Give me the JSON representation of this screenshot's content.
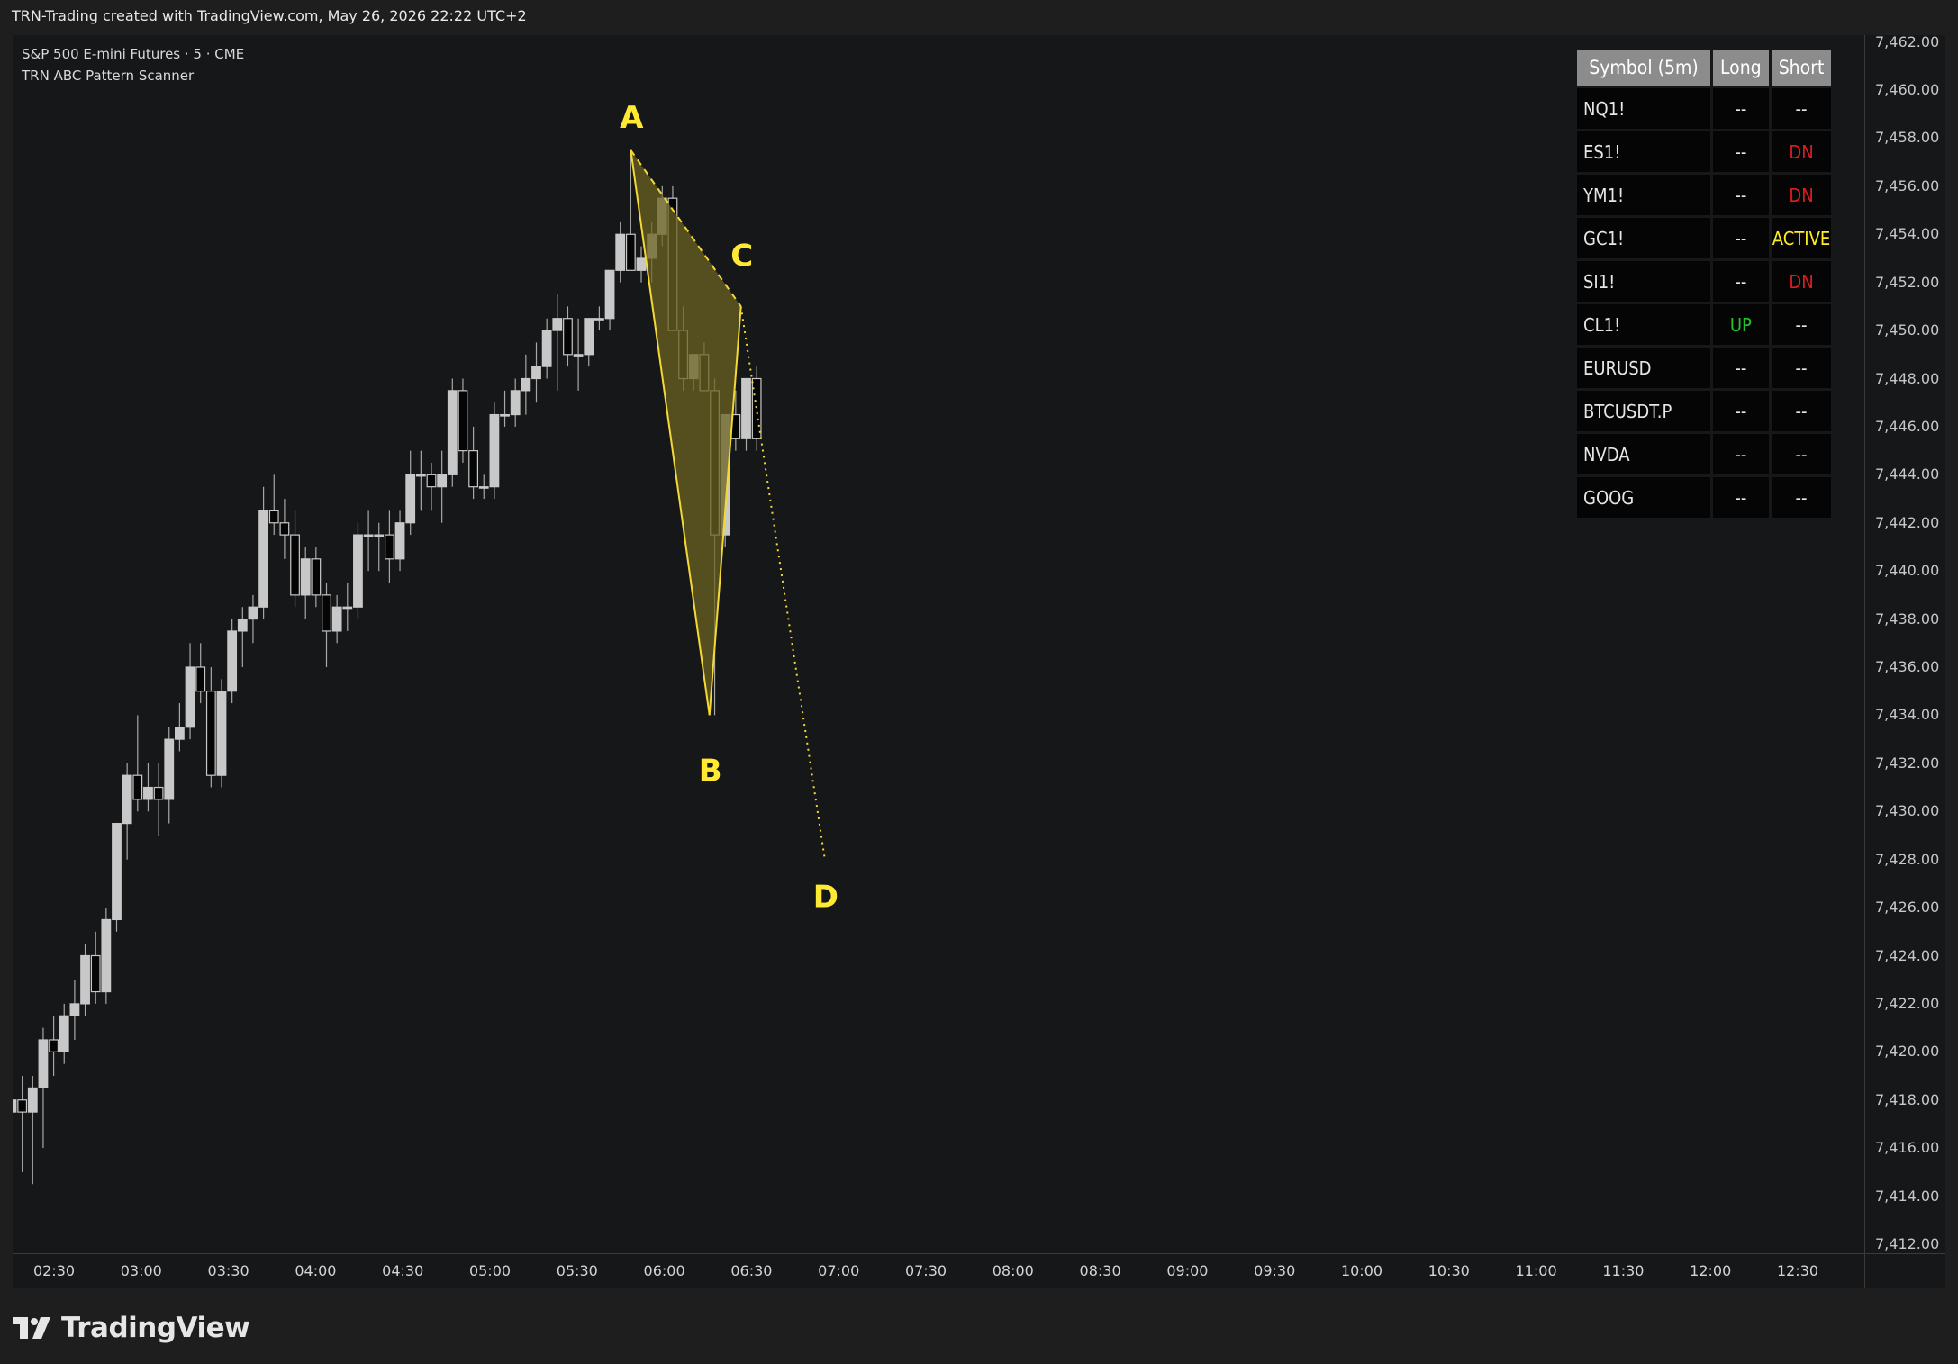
{
  "header": {
    "title": "TRN-Trading created with TradingView.com, May 26, 2026 22:22 UTC+2"
  },
  "legend": {
    "symbol": "S&P 500 E-mini Futures · 5 · CME",
    "indicator": "TRN ABC Pattern Scanner"
  },
  "logo": {
    "text": "TradingView"
  },
  "scanner": {
    "headers": [
      "Symbol (5m)",
      "Long",
      "Short"
    ],
    "rows": [
      {
        "symbol": "NQ1!",
        "long": "--",
        "short": "--"
      },
      {
        "symbol": "ES1!",
        "long": "--",
        "short": "DN"
      },
      {
        "symbol": "YM1!",
        "long": "--",
        "short": "DN"
      },
      {
        "symbol": "GC1!",
        "long": "--",
        "short": "ACTIVE"
      },
      {
        "symbol": "SI1!",
        "long": "--",
        "short": "DN"
      },
      {
        "symbol": "CL1!",
        "long": "UP",
        "short": "--"
      },
      {
        "symbol": "EURUSD",
        "long": "--",
        "short": "--"
      },
      {
        "symbol": "BTCUSDT.P",
        "long": "--",
        "short": "--"
      },
      {
        "symbol": "NVDA",
        "long": "--",
        "short": "--"
      },
      {
        "symbol": "GOOG",
        "long": "--",
        "short": "--"
      }
    ],
    "colors": {
      "UP": "#22c52e",
      "DN": "#e01d1d",
      "ACTIVE": "#ffee22",
      "--": "#e6e6e6"
    }
  },
  "colors": {
    "bull": "#c8c8c8",
    "bear": "#050505",
    "wick": "#a8a8a8",
    "pattern": "#f4d836",
    "pattern_fill": "#6b6322",
    "label": "#ffe933"
  },
  "chart_data": {
    "type": "candlestick",
    "x_ticks": [
      "02:30",
      "03:00",
      "03:30",
      "04:00",
      "04:30",
      "05:00",
      "05:30",
      "06:00",
      "06:30",
      "07:00",
      "07:30",
      "08:00",
      "08:30",
      "09:00",
      "09:30",
      "10:00",
      "10:30",
      "11:00",
      "11:30",
      "12:00",
      "12:30"
    ],
    "y_ticks": [
      "7,462.00",
      "7,460.00",
      "7,458.00",
      "7,456.00",
      "7,454.00",
      "7,452.00",
      "7,450.00",
      "7,448.00",
      "7,446.00",
      "7,444.00",
      "7,442.00",
      "7,440.00",
      "7,438.00",
      "7,436.00",
      "7,434.00",
      "7,432.00",
      "7,430.00",
      "7,428.00",
      "7,426.00",
      "7,424.00",
      "7,422.00",
      "7,420.00",
      "7,418.00",
      "7,416.00",
      "7,414.00",
      "7,412.00"
    ],
    "ylim": [
      7410.5,
      7462.8
    ],
    "candles": [
      [
        7417.5,
        7420.5,
        7416.5,
        7418.0
      ],
      [
        7418.0,
        7419.0,
        7415.0,
        7417.5
      ],
      [
        7417.5,
        7419.0,
        7414.5,
        7418.5
      ],
      [
        7418.5,
        7421.0,
        7416.0,
        7420.5
      ],
      [
        7420.5,
        7421.5,
        7419.0,
        7420.0
      ],
      [
        7420.0,
        7422.0,
        7419.5,
        7421.5
      ],
      [
        7421.5,
        7423.0,
        7420.5,
        7422.0
      ],
      [
        7422.0,
        7424.5,
        7421.5,
        7424.0
      ],
      [
        7424.0,
        7425.0,
        7422.0,
        7422.5
      ],
      [
        7422.5,
        7426.0,
        7422.0,
        7425.5
      ],
      [
        7425.5,
        7429.5,
        7425.0,
        7429.5
      ],
      [
        7429.5,
        7432.0,
        7428.0,
        7431.5
      ],
      [
        7431.5,
        7434.0,
        7430.0,
        7430.5
      ],
      [
        7430.5,
        7432.0,
        7430.0,
        7431.0
      ],
      [
        7431.0,
        7432.0,
        7429.0,
        7430.5
      ],
      [
        7430.5,
        7433.5,
        7429.5,
        7433.0
      ],
      [
        7433.0,
        7434.5,
        7432.5,
        7433.5
      ],
      [
        7433.5,
        7437.0,
        7433.0,
        7436.0
      ],
      [
        7436.0,
        7437.0,
        7434.5,
        7435.0
      ],
      [
        7435.0,
        7436.0,
        7431.0,
        7431.5
      ],
      [
        7431.5,
        7435.5,
        7431.0,
        7435.0
      ],
      [
        7435.0,
        7438.0,
        7434.5,
        7437.5
      ],
      [
        7437.5,
        7438.5,
        7436.0,
        7438.0
      ],
      [
        7438.0,
        7439.0,
        7437.0,
        7438.5
      ],
      [
        7438.5,
        7443.5,
        7438.0,
        7442.5
      ],
      [
        7442.5,
        7444.0,
        7441.5,
        7442.0
      ],
      [
        7442.0,
        7443.0,
        7440.5,
        7441.5
      ],
      [
        7441.5,
        7442.5,
        7438.5,
        7439.0
      ],
      [
        7439.0,
        7441.0,
        7438.0,
        7440.5
      ],
      [
        7440.5,
        7441.0,
        7438.5,
        7439.0
      ],
      [
        7439.0,
        7439.5,
        7436.0,
        7437.5
      ],
      [
        7437.5,
        7439.0,
        7437.0,
        7438.5
      ],
      [
        7438.5,
        7439.5,
        7437.5,
        7438.5
      ],
      [
        7438.5,
        7442.0,
        7438.0,
        7441.5
      ],
      [
        7441.5,
        7442.5,
        7440.0,
        7441.5
      ],
      [
        7441.5,
        7442.0,
        7440.0,
        7441.5
      ],
      [
        7441.5,
        7442.5,
        7439.5,
        7440.5
      ],
      [
        7440.5,
        7442.5,
        7440.0,
        7442.0
      ],
      [
        7442.0,
        7445.0,
        7441.5,
        7444.0
      ],
      [
        7444.0,
        7445.0,
        7442.5,
        7444.0
      ],
      [
        7444.0,
        7444.5,
        7442.5,
        7443.5
      ],
      [
        7443.5,
        7445.0,
        7442.0,
        7444.0
      ],
      [
        7444.0,
        7448.0,
        7443.5,
        7447.5
      ],
      [
        7447.5,
        7448.0,
        7444.5,
        7445.0
      ],
      [
        7445.0,
        7446.0,
        7443.0,
        7443.5
      ],
      [
        7443.5,
        7444.0,
        7443.0,
        7443.5
      ],
      [
        7443.5,
        7447.0,
        7443.0,
        7446.5
      ],
      [
        7446.5,
        7447.5,
        7446.0,
        7446.5
      ],
      [
        7446.5,
        7448.0,
        7446.0,
        7447.5
      ],
      [
        7447.5,
        7449.0,
        7446.5,
        7448.0
      ],
      [
        7448.0,
        7449.5,
        7447.0,
        7448.5
      ],
      [
        7448.5,
        7450.5,
        7448.0,
        7450.0
      ],
      [
        7450.0,
        7451.5,
        7447.5,
        7450.5
      ],
      [
        7450.5,
        7451.0,
        7448.5,
        7449.0
      ],
      [
        7449.0,
        7450.5,
        7447.5,
        7449.0
      ],
      [
        7449.0,
        7450.5,
        7448.5,
        7450.5
      ],
      [
        7450.5,
        7451.0,
        7450.0,
        7450.5
      ],
      [
        7450.5,
        7452.5,
        7450.0,
        7452.5
      ],
      [
        7452.5,
        7454.5,
        7452.0,
        7454.0
      ],
      [
        7454.0,
        7457.5,
        7452.5,
        7452.5
      ],
      [
        7452.5,
        7453.5,
        7452.0,
        7453.0
      ],
      [
        7453.0,
        7454.5,
        7452.0,
        7454.0
      ],
      [
        7454.0,
        7456.0,
        7453.5,
        7455.5
      ],
      [
        7455.5,
        7456.0,
        7450.0,
        7450.0
      ],
      [
        7450.0,
        7451.0,
        7447.5,
        7448.0
      ],
      [
        7448.0,
        7449.0,
        7447.5,
        7449.0
      ],
      [
        7449.0,
        7449.5,
        7447.5,
        7447.5
      ],
      [
        7447.5,
        7448.0,
        7434.0,
        7441.5
      ],
      [
        7441.5,
        7446.5,
        7441.0,
        7446.5
      ],
      [
        7446.5,
        7447.5,
        7445.0,
        7445.5
      ],
      [
        7445.5,
        7448.0,
        7445.0,
        7448.0
      ],
      [
        7448.0,
        7448.5,
        7445.0,
        7445.5
      ]
    ],
    "pattern": {
      "A": 7457.5,
      "B": 7434.0,
      "C": 7451.0,
      "D": 7428.0,
      "labels": [
        "A",
        "B",
        "C",
        "D"
      ]
    }
  }
}
